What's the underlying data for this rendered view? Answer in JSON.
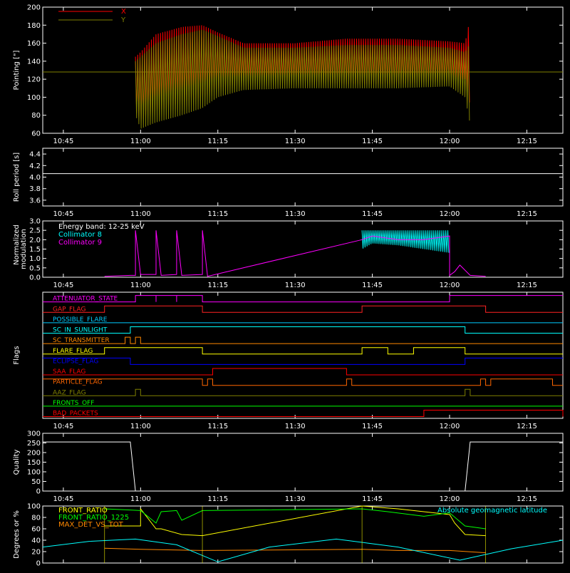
{
  "chart_data": [
    {
      "id": "pointing",
      "type": "line",
      "ylabel": "Pointing [\"]",
      "ylim": [
        60,
        200
      ],
      "y_ticks": [
        60,
        80,
        100,
        120,
        140,
        160,
        180,
        200
      ],
      "x_tick_labels": [
        "10:45",
        "11:00",
        "11:15",
        "11:30",
        "11:45",
        "12:00",
        "12:15"
      ],
      "legend": {
        "placement": "top-left",
        "entries": [
          {
            "name": "X",
            "color": "#ff0000"
          },
          {
            "name": "Y",
            "color": "#808000"
          }
        ]
      },
      "baseline_value": 128,
      "series": [
        {
          "name": "X",
          "color": "#ff0000",
          "x": [
            "10:59",
            "11:00",
            "11:03",
            "11:08",
            "11:12",
            "11:15",
            "11:20",
            "11:30",
            "11:40",
            "11:50",
            "12:00",
            "12:03",
            "12:04"
          ],
          "upper": [
            145,
            150,
            170,
            178,
            180,
            172,
            160,
            160,
            165,
            165,
            162,
            160,
            188
          ],
          "lower": [
            85,
            75,
            85,
            95,
            100,
            110,
            118,
            118,
            115,
            115,
            118,
            120,
            90
          ]
        },
        {
          "name": "Y",
          "color": "#808000",
          "x": [
            "10:59",
            "11:00",
            "11:03",
            "11:08",
            "11:12",
            "11:15",
            "11:20",
            "11:30",
            "11:40",
            "11:50",
            "12:00",
            "12:03",
            "12:04"
          ],
          "upper": [
            140,
            145,
            160,
            170,
            175,
            168,
            155,
            155,
            158,
            158,
            155,
            150,
            160
          ],
          "lower": [
            80,
            65,
            72,
            80,
            88,
            100,
            108,
            110,
            110,
            110,
            112,
            100,
            70
          ]
        }
      ]
    },
    {
      "id": "roll",
      "type": "line",
      "ylabel": "Roll period [s]",
      "ylim": [
        3.5,
        4.5
      ],
      "y_ticks": [
        3.6,
        3.8,
        4.0,
        4.2,
        4.4
      ],
      "x_tick_labels": [
        "10:45",
        "11:00",
        "11:15",
        "11:30",
        "11:45",
        "12:00",
        "12:15"
      ],
      "series": [
        {
          "name": "",
          "color": "#ffffff",
          "x": [
            "10:41",
            "12:22"
          ],
          "y": [
            4.06,
            4.06
          ]
        }
      ]
    },
    {
      "id": "modulation",
      "type": "line",
      "ylabel": "Normalized modulation",
      "ylim": [
        0,
        3
      ],
      "y_ticks": [
        0.0,
        0.5,
        1.0,
        1.5,
        2.0,
        2.5,
        3.0
      ],
      "x_tick_labels": [
        "10:45",
        "11:00",
        "11:15",
        "11:30",
        "11:45",
        "12:00",
        "12:15"
      ],
      "legend": {
        "placement": "top-left",
        "entries": [
          {
            "name": "Energy band: 12-25 keV",
            "color": "#ffffff"
          },
          {
            "name": "Collimator 8",
            "color": "#00ffff"
          },
          {
            "name": "Collimator 9",
            "color": "#ff00ff"
          }
        ]
      },
      "series": [
        {
          "name": "Collimator 8",
          "color": "#00ffff",
          "x": [
            "11:43",
            "11:45",
            "11:50",
            "11:55",
            "12:00",
            "12:00"
          ],
          "upper": [
            2.5,
            2.5,
            2.5,
            2.5,
            2.5,
            2.5
          ],
          "lower": [
            1.5,
            1.8,
            1.7,
            1.5,
            1.3,
            1.3
          ]
        },
        {
          "name": "Collimator 9",
          "color": "#ff00ff",
          "x": [
            "10:53",
            "10:58",
            "10:59",
            "10:59",
            "11:00",
            "11:03",
            "11:03",
            "11:04",
            "11:07",
            "11:07",
            "11:08",
            "11:12",
            "11:12",
            "11:13",
            "11:43",
            "11:45",
            "11:50",
            "11:55",
            "12:00",
            "12:00",
            "12:01",
            "12:02",
            "12:04",
            "12:07"
          ],
          "y": [
            0.05,
            0.1,
            0.1,
            2.5,
            0.15,
            0.15,
            2.5,
            0.1,
            0.15,
            2.5,
            0.1,
            0.15,
            2.5,
            0.05,
            2.0,
            2.2,
            2.0,
            2.0,
            2.2,
            0.1,
            0.3,
            0.65,
            0.1,
            0.05
          ]
        }
      ]
    },
    {
      "id": "flags",
      "type": "line",
      "ylabel": "Flags",
      "x_tick_labels": [
        "10:45",
        "11:00",
        "11:15",
        "11:30",
        "11:45",
        "12:00",
        "12:15"
      ],
      "flags": [
        {
          "name": "ATTENUATOR_STATE",
          "color": "#ff00ff",
          "x": [
            "10:41",
            "10:59",
            "10:59",
            "11:03",
            "11:03",
            "11:07",
            "11:07",
            "11:12",
            "12:00",
            "12:22"
          ],
          "y": [
            0,
            0,
            1,
            0,
            1,
            0,
            1,
            0,
            1,
            1
          ]
        },
        {
          "name": "GAP_FLAG",
          "color": "#ff2222",
          "x": [
            "10:41",
            "10:53",
            "11:12",
            "11:43",
            "12:07",
            "12:22"
          ],
          "y": [
            0,
            1,
            0,
            1,
            0,
            0
          ]
        },
        {
          "name": "POSSIBLE_FLARE",
          "color": "#00ccff",
          "x": [
            "10:41",
            "12:22"
          ],
          "y": [
            0,
            0
          ]
        },
        {
          "name": "SC_IN_SUNLIGHT",
          "color": "#00ffff",
          "x": [
            "10:41",
            "10:58",
            "12:03",
            "12:22"
          ],
          "y": [
            0,
            1,
            0,
            0
          ]
        },
        {
          "name": "SC_TRANSMITTER",
          "color": "#ff8800",
          "x": [
            "10:41",
            "10:57",
            "10:58",
            "10:59",
            "11:00",
            "12:22"
          ],
          "y": [
            0,
            1,
            0,
            1,
            0,
            0
          ]
        },
        {
          "name": "FLARE_FLAG",
          "color": "#ffff00",
          "x": [
            "10:41",
            "10:53",
            "11:12",
            "11:43",
            "11:48",
            "11:53",
            "12:03",
            "12:22"
          ],
          "y": [
            0,
            1,
            0,
            1,
            0,
            1,
            0,
            0
          ]
        },
        {
          "name": "ECLIPSE_FLAG",
          "color": "#0000ff",
          "x": [
            "10:41",
            "10:58",
            "12:03",
            "12:22"
          ],
          "y": [
            1,
            0,
            1,
            1
          ]
        },
        {
          "name": "SAA_FLAG",
          "color": "#ff0000",
          "x": [
            "10:41",
            "11:14",
            "11:40",
            "12:22"
          ],
          "y": [
            0,
            1,
            0,
            0
          ]
        },
        {
          "name": "PARTICLE_FLAG",
          "color": "#ff6600",
          "x": [
            "10:41",
            "11:12",
            "11:13",
            "11:14",
            "11:40",
            "11:41",
            "12:06",
            "12:07",
            "12:08",
            "12:20",
            "12:22"
          ],
          "y": [
            1,
            0,
            1,
            0,
            1,
            0,
            1,
            0,
            1,
            0,
            0
          ]
        },
        {
          "name": "AAZ_FLAG",
          "color": "#808000",
          "x": [
            "10:41",
            "10:59",
            "11:00",
            "12:03",
            "12:04",
            "12:22"
          ],
          "y": [
            0,
            1,
            0,
            1,
            0,
            0
          ]
        },
        {
          "name": "FRONTS_OFF",
          "color": "#00ff00",
          "x": [
            "10:41",
            "12:22"
          ],
          "y": [
            0,
            0
          ]
        },
        {
          "name": "BAD_PACKETS",
          "color": "#ff0000",
          "x": [
            "10:41",
            "11:55",
            "11:55",
            "12:22"
          ],
          "y": [
            0,
            0,
            1,
            0
          ]
        }
      ]
    },
    {
      "id": "quality",
      "type": "line",
      "ylabel": "Quality",
      "ylim": [
        0,
        300
      ],
      "y_ticks": [
        0,
        50,
        100,
        150,
        200,
        250,
        300
      ],
      "x_tick_labels": [
        "10:45",
        "11:00",
        "11:15",
        "11:30",
        "11:45",
        "12:00",
        "12:15"
      ],
      "series": [
        {
          "name": "",
          "color": "#ffffff",
          "x": [
            "10:41",
            "10:58",
            "10:59",
            "12:03",
            "12:04",
            "12:22"
          ],
          "y": [
            255,
            255,
            0,
            0,
            255,
            255
          ]
        }
      ]
    },
    {
      "id": "front_ratio",
      "type": "line",
      "ylabel": "Degrees or %",
      "ylim": [
        0,
        100
      ],
      "y_ticks": [
        0,
        20,
        40,
        60,
        80,
        100
      ],
      "legend": {
        "placement": "top-left",
        "entries": [
          {
            "name": "FRONT_RATIO",
            "color": "#ffff00"
          },
          {
            "name": "FRONT_RATIO_1225",
            "color": "#00ff00"
          },
          {
            "name": "MAX_DET_VS_TOT",
            "color": "#ff8800"
          }
        ]
      },
      "extra_legend": {
        "placement": "top-right",
        "entries": [
          {
            "name": "Absolute geomagnetic latitude",
            "color": "#00ffff"
          }
        ]
      },
      "series": [
        {
          "name": "FRONT_RATIO",
          "color": "#ffff00",
          "x": [
            "10:53",
            "11:00",
            "11:00",
            "11:03",
            "11:04",
            "11:08",
            "11:08",
            "11:12",
            "11:43",
            "11:50",
            "11:55",
            "12:00",
            "12:01",
            "12:03",
            "12:07"
          ],
          "y": [
            65,
            65,
            95,
            60,
            60,
            50,
            50,
            48,
            100,
            95,
            90,
            85,
            70,
            50,
            48
          ]
        },
        {
          "name": "FRONT_RATIO_1225",
          "color": "#00ff00",
          "x": [
            "10:53",
            "10:58",
            "11:00",
            "11:03",
            "11:04",
            "11:07",
            "11:08",
            "11:12",
            "11:43",
            "11:48",
            "11:55",
            "12:00",
            "12:03",
            "12:07"
          ],
          "y": [
            95,
            93,
            92,
            70,
            90,
            92,
            75,
            92,
            95,
            90,
            82,
            88,
            65,
            60
          ]
        },
        {
          "name": "MAX_DET_VS_TOT",
          "color": "#ff8800",
          "x": [
            "10:53",
            "11:00",
            "11:12",
            "11:43",
            "11:50",
            "12:00",
            "12:07"
          ],
          "y": [
            26,
            24,
            22,
            24,
            22,
            22,
            18
          ]
        },
        {
          "name": "Absolute geomagnetic latitude",
          "color": "#00ffff",
          "x": [
            "10:41",
            "10:50",
            "10:59",
            "11:07",
            "11:15",
            "11:25",
            "11:38",
            "11:50",
            "12:02",
            "12:12",
            "12:22"
          ],
          "y": [
            28,
            38,
            42,
            32,
            2,
            28,
            42,
            28,
            5,
            25,
            40
          ]
        }
      ]
    }
  ]
}
